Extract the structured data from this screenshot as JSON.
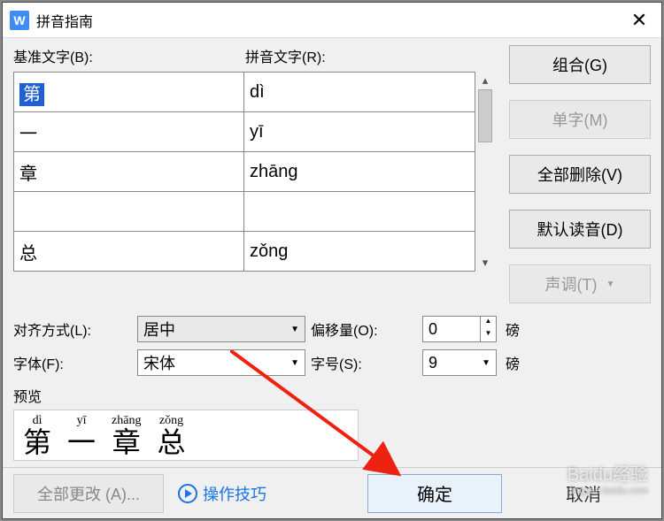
{
  "title": "拼音指南",
  "labels": {
    "base_text": "基准文字(B):",
    "ruby_text": "拼音文字(R):",
    "align": "对齐方式(L):",
    "offset": "偏移量(O):",
    "font": "字体(F):",
    "size": "字号(S):",
    "unit": "磅",
    "preview": "预览"
  },
  "table": {
    "rows": [
      {
        "base": "第",
        "ruby": "dì",
        "selected": true
      },
      {
        "base": "一",
        "ruby": "yī",
        "selected": false
      },
      {
        "base": "章",
        "ruby": "zhāng",
        "selected": false
      },
      {
        "base": "",
        "ruby": "",
        "selected": false
      },
      {
        "base": "总",
        "ruby": "zǒng",
        "selected": false
      }
    ]
  },
  "side_buttons": {
    "combine": "组合(G)",
    "mono": "单字(M)",
    "clear": "全部删除(V)",
    "default": "默认读音(D)",
    "tone": "声调(T)"
  },
  "form": {
    "align_value": "居中",
    "offset_value": "0",
    "font_value": "宋体",
    "size_value": "9"
  },
  "preview_ruby": [
    {
      "py": "dì",
      "hz": "第"
    },
    {
      "py": "yī",
      "hz": "一"
    },
    {
      "py": "zhāng",
      "hz": "章"
    },
    {
      "py": "zǒng",
      "hz": "总"
    }
  ],
  "footer": {
    "change_all": "全部更改 (A)...",
    "tips": "操作技巧",
    "ok": "确定",
    "cancel": "取消"
  },
  "watermark": {
    "brand": "Baidu经验",
    "url": "jingyan.baidu.com"
  }
}
